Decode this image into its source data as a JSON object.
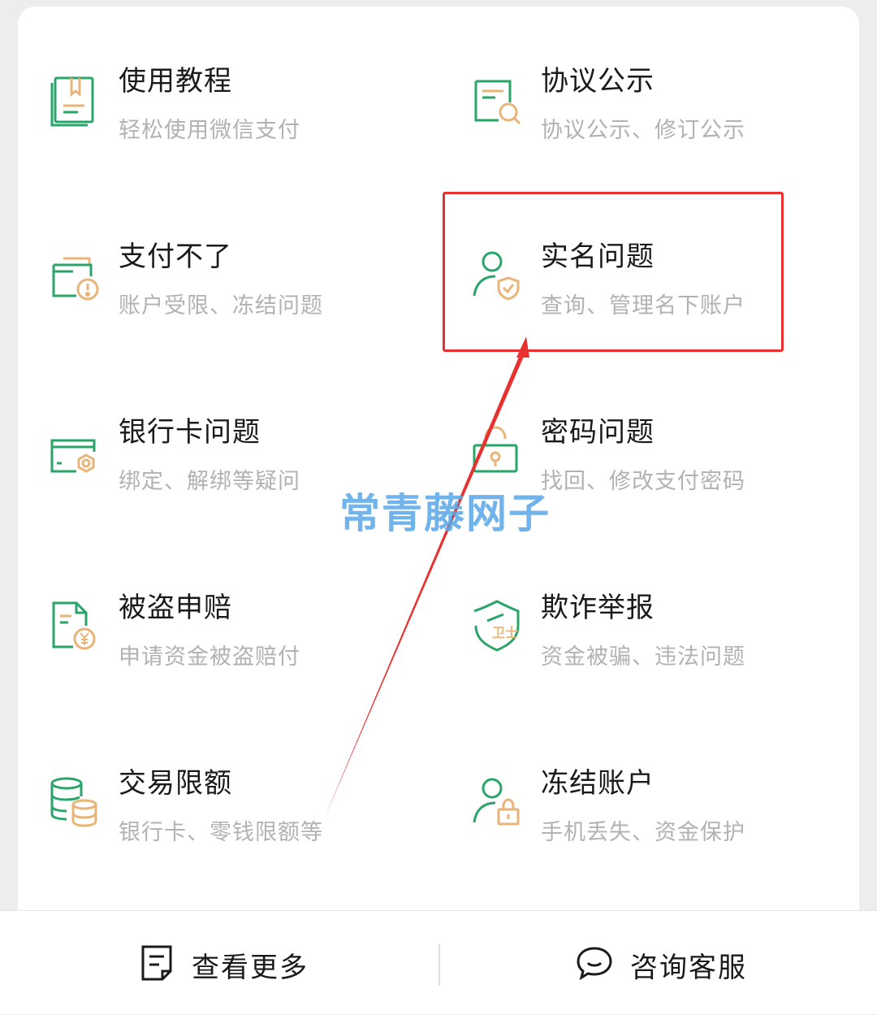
{
  "colors": {
    "green": "#2aa56a",
    "orange": "#e8b478",
    "highlight": "#e8312f",
    "watermark": "#58a8e8"
  },
  "items": [
    {
      "title": "使用教程",
      "desc": "轻松使用微信支付",
      "icon": "book-icon"
    },
    {
      "title": "协议公示",
      "desc": "协议公示、修订公示",
      "icon": "document-search-icon"
    },
    {
      "title": "支付不了",
      "desc": "账户受限、冻结问题",
      "icon": "wallet-warning-icon"
    },
    {
      "title": "实名问题",
      "desc": "查询、管理名下账户",
      "icon": "user-shield-icon"
    },
    {
      "title": "银行卡问题",
      "desc": "绑定、解绑等疑问",
      "icon": "bank-card-icon"
    },
    {
      "title": "密码问题",
      "desc": "找回、修改支付密码",
      "icon": "lock-icon"
    },
    {
      "title": "被盗申赔",
      "desc": "申请资金被盗赔付",
      "icon": "document-yen-icon"
    },
    {
      "title": "欺诈举报",
      "desc": "资金被骗、违法问题",
      "icon": "guard-shield-icon"
    },
    {
      "title": "交易限额",
      "desc": "银行卡、零钱限额等",
      "icon": "coin-stack-icon"
    },
    {
      "title": "冻结账户",
      "desc": "手机丢失、资金保护",
      "icon": "user-lock-icon"
    }
  ],
  "watermark": "常青藤网子",
  "bottom": {
    "more_label": "查看更多",
    "more_icon": "note-icon",
    "service_label": "咨询客服",
    "service_icon": "chat-bubble-icon"
  }
}
